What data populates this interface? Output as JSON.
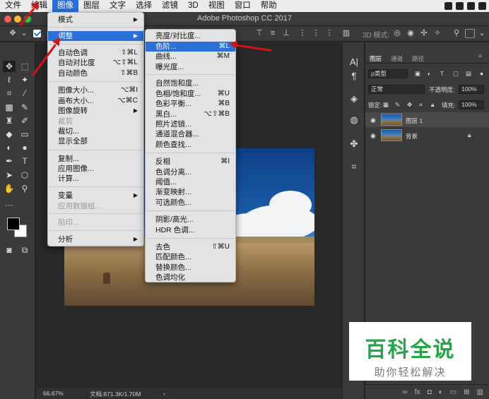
{
  "menubar": {
    "items": [
      "文件",
      "编辑",
      "图像",
      "图层",
      "文字",
      "选择",
      "滤镜",
      "3D",
      "视图",
      "窗口",
      "帮助"
    ],
    "active_index": 2
  },
  "titlebar": {
    "title": "Adobe Photoshop CC 2017"
  },
  "optbar": {
    "mode3d": "3D 模式:"
  },
  "image_menu": {
    "items": [
      {
        "label": "模式",
        "shortcut": "",
        "submenu": true,
        "disabled": false
      },
      {
        "label": "调整",
        "shortcut": "",
        "submenu": true,
        "disabled": false,
        "highlighted": true
      },
      {
        "label": "自动色调",
        "shortcut": "⇧⌘L"
      },
      {
        "label": "自动对比度",
        "shortcut": "⌥⇧⌘L"
      },
      {
        "label": "自动颜色",
        "shortcut": "⇧⌘B"
      },
      {
        "label": "图像大小...",
        "shortcut": "⌥⌘I"
      },
      {
        "label": "画布大小...",
        "shortcut": "⌥⌘C"
      },
      {
        "label": "图像旋转",
        "shortcut": "",
        "submenu": true
      },
      {
        "label": "裁剪",
        "shortcut": "",
        "disabled": true
      },
      {
        "label": "裁切...",
        "shortcut": ""
      },
      {
        "label": "显示全部",
        "shortcut": ""
      },
      {
        "label": "复制...",
        "shortcut": ""
      },
      {
        "label": "应用图像...",
        "shortcut": ""
      },
      {
        "label": "计算...",
        "shortcut": ""
      },
      {
        "label": "变量",
        "shortcut": "",
        "submenu": true
      },
      {
        "label": "应用数据组...",
        "shortcut": "",
        "disabled": true
      },
      {
        "label": "陷印...",
        "shortcut": "",
        "disabled": true
      },
      {
        "label": "分析",
        "shortcut": "",
        "submenu": true
      }
    ]
  },
  "adjust_menu": {
    "items": [
      {
        "label": "亮度/对比度...",
        "shortcut": ""
      },
      {
        "label": "色阶...",
        "shortcut": "⌘L",
        "highlighted": true
      },
      {
        "label": "曲线...",
        "shortcut": "⌘M"
      },
      {
        "label": "曝光度...",
        "shortcut": ""
      },
      {
        "label": "自然饱和度...",
        "shortcut": ""
      },
      {
        "label": "色相/饱和度...",
        "shortcut": "⌘U"
      },
      {
        "label": "色彩平衡...",
        "shortcut": "⌘B"
      },
      {
        "label": "黑白...",
        "shortcut": "⌥⇧⌘B"
      },
      {
        "label": "照片滤镜...",
        "shortcut": ""
      },
      {
        "label": "通道混合器...",
        "shortcut": ""
      },
      {
        "label": "颜色查找...",
        "shortcut": ""
      },
      {
        "label": "反相",
        "shortcut": "⌘I"
      },
      {
        "label": "色调分离...",
        "shortcut": ""
      },
      {
        "label": "阈值...",
        "shortcut": ""
      },
      {
        "label": "渐变映射...",
        "shortcut": ""
      },
      {
        "label": "可选颜色...",
        "shortcut": ""
      },
      {
        "label": "阴影/高光...",
        "shortcut": ""
      },
      {
        "label": "HDR 色调...",
        "shortcut": ""
      },
      {
        "label": "去色",
        "shortcut": "⇧⌘U"
      },
      {
        "label": "匹配颜色...",
        "shortcut": ""
      },
      {
        "label": "替换颜色...",
        "shortcut": ""
      },
      {
        "label": "色调均化",
        "shortcut": ""
      }
    ]
  },
  "panel": {
    "tabs": [
      "图层",
      "通道",
      "路径"
    ],
    "kind_label": "ρ类型",
    "blend_mode": "正常",
    "opacity_label": "不透明度:",
    "opacity_value": "100%",
    "lock_label": "锁定:",
    "fill_label": "填充:",
    "fill_value": "100%",
    "layers": [
      {
        "name": "图层 1",
        "selected": true
      },
      {
        "name": "背景",
        "selected": false,
        "locked": true
      }
    ]
  },
  "status": {
    "zoom": "66.67%",
    "doc": "文档:871.3K/1.70M"
  },
  "watermark": {
    "title": "百科全说",
    "subtitle": "助你轻松解决"
  },
  "colors": {
    "accent": "#2c6fd6",
    "arrow": "#d41414",
    "brand_green": "#25a548"
  }
}
